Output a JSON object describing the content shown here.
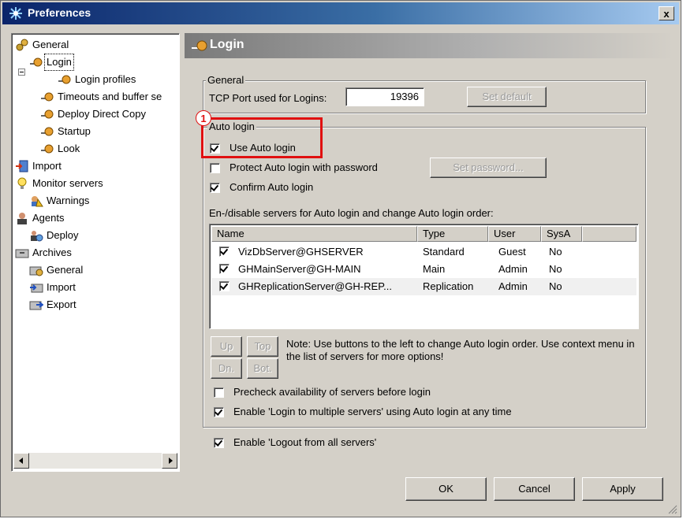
{
  "window": {
    "title": "Preferences",
    "close_label": "x"
  },
  "tree": {
    "items": [
      {
        "label": "General"
      },
      {
        "label": "Login"
      },
      {
        "label": "Login profiles"
      },
      {
        "label": "Timeouts and buffer se"
      },
      {
        "label": "Deploy Direct Copy"
      },
      {
        "label": "Startup"
      },
      {
        "label": "Look"
      },
      {
        "label": "Import"
      },
      {
        "label": "Monitor servers"
      },
      {
        "label": "Warnings"
      },
      {
        "label": "Agents"
      },
      {
        "label": "Deploy"
      },
      {
        "label": "Archives"
      },
      {
        "label": "General"
      },
      {
        "label": "Import"
      },
      {
        "label": "Export"
      }
    ]
  },
  "panel": {
    "title": "Login"
  },
  "general_group": {
    "label": "General",
    "tcp_label": "TCP Port used for Logins:",
    "tcp_value": "19396",
    "set_default": "Set default"
  },
  "auto_group": {
    "label": "Auto login",
    "badge": "1",
    "use_auto": "Use Auto login",
    "protect": "Protect Auto login with password",
    "set_password": "Set password...",
    "confirm": "Confirm Auto login",
    "servers_label": "En-/disable servers for Auto login and change Auto login order:",
    "columns": [
      "Name",
      "Type",
      "User",
      "SysA"
    ],
    "rows": [
      {
        "name": "VizDbServer@GHSERVER",
        "type": "Standard",
        "user": "Guest",
        "sysa": "No"
      },
      {
        "name": "GHMainServer@GH-MAIN",
        "type": "Main",
        "user": "Admin",
        "sysa": "No"
      },
      {
        "name": "GHReplicationServer@GH-REP...",
        "type": "Replication",
        "user": "Admin",
        "sysa": "No"
      }
    ],
    "up": "Up",
    "top": "Top",
    "dn": "Dn.",
    "bot": "Bot.",
    "note": "Note: Use buttons to the left to change Auto login order. Use context menu in the list of servers for more options!",
    "precheck": "Precheck availability of servers before login",
    "enable_multi": "Enable 'Login to multiple servers' using Auto login at any time"
  },
  "logout_all": "Enable 'Logout from all servers'",
  "buttons": {
    "ok": "OK",
    "cancel": "Cancel",
    "apply": "Apply"
  }
}
